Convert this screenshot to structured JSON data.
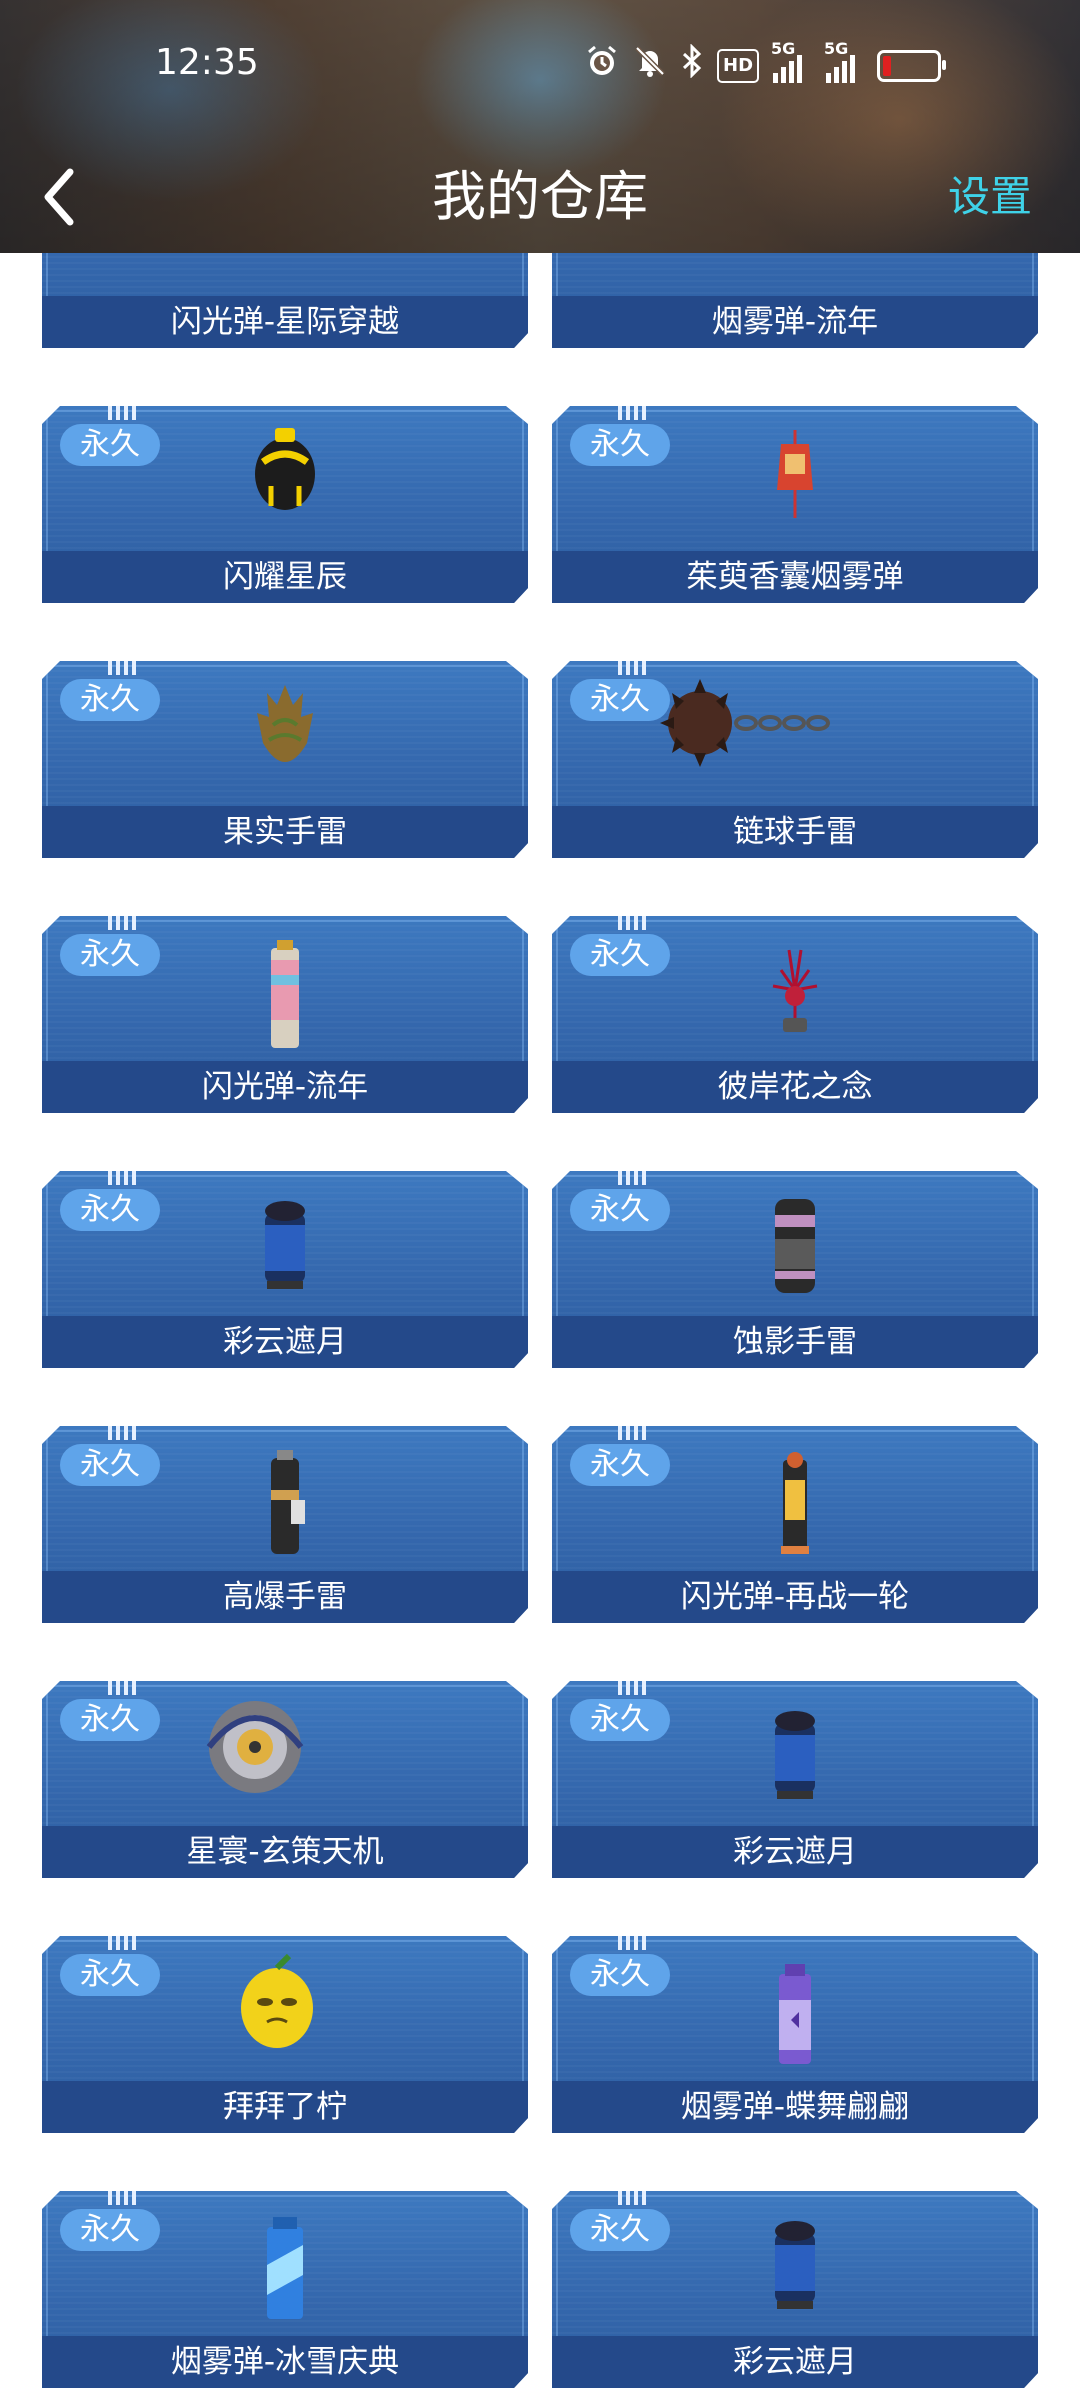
{
  "status_bar": {
    "time": "12:35",
    "icons": [
      "alarm-icon",
      "mute-icon",
      "bluetooth-icon",
      "hd-icon",
      "signal-5g-icon",
      "signal-5g-icon",
      "battery-low-icon"
    ],
    "hd_label": "HD",
    "network_1": "5G",
    "network_2": "5G"
  },
  "nav": {
    "title": "我的仓库",
    "settings": "设置"
  },
  "badge_text": "永久",
  "items": [
    {
      "label": "闪光弹-星际穿越",
      "badge": "",
      "icon": "flash-grenade-icon"
    },
    {
      "label": "烟雾弹-流年",
      "badge": "",
      "icon": "smoke-grenade-icon"
    },
    {
      "label": "闪耀星辰",
      "badge": "永久",
      "icon": "shining-grenade-icon"
    },
    {
      "label": "茱萸香囊烟雾弹",
      "badge": "永久",
      "icon": "sachet-smoke-icon"
    },
    {
      "label": "果实手雷",
      "badge": "永久",
      "icon": "fruit-grenade-icon"
    },
    {
      "label": "链球手雷",
      "badge": "永久",
      "icon": "flail-grenade-icon"
    },
    {
      "label": "闪光弹-流年",
      "badge": "永久",
      "icon": "flash-canister-icon"
    },
    {
      "label": "彼岸花之念",
      "badge": "永久",
      "icon": "spider-lily-icon"
    },
    {
      "label": "彩云遮月",
      "badge": "永久",
      "icon": "lantern-grenade-icon"
    },
    {
      "label": "蚀影手雷",
      "badge": "永久",
      "icon": "shadow-grenade-icon"
    },
    {
      "label": "高爆手雷",
      "badge": "永久",
      "icon": "frag-grenade-icon"
    },
    {
      "label": "闪光弹-再战一轮",
      "badge": "永久",
      "icon": "flash-tower-icon"
    },
    {
      "label": "星寰-玄策天机",
      "badge": "永久",
      "icon": "gear-disc-icon"
    },
    {
      "label": "彩云遮月",
      "badge": "永久",
      "icon": "lantern-grenade-icon"
    },
    {
      "label": "拜拜了柠",
      "badge": "永久",
      "icon": "lemon-grenade-icon"
    },
    {
      "label": "烟雾弹-蝶舞翩翩",
      "badge": "永久",
      "icon": "butterfly-smoke-icon"
    },
    {
      "label": "烟雾弹-冰雪庆典",
      "badge": "永久",
      "icon": "ice-smoke-icon"
    },
    {
      "label": "彩云遮月",
      "badge": "永久",
      "icon": "lantern-grenade-icon"
    }
  ]
}
